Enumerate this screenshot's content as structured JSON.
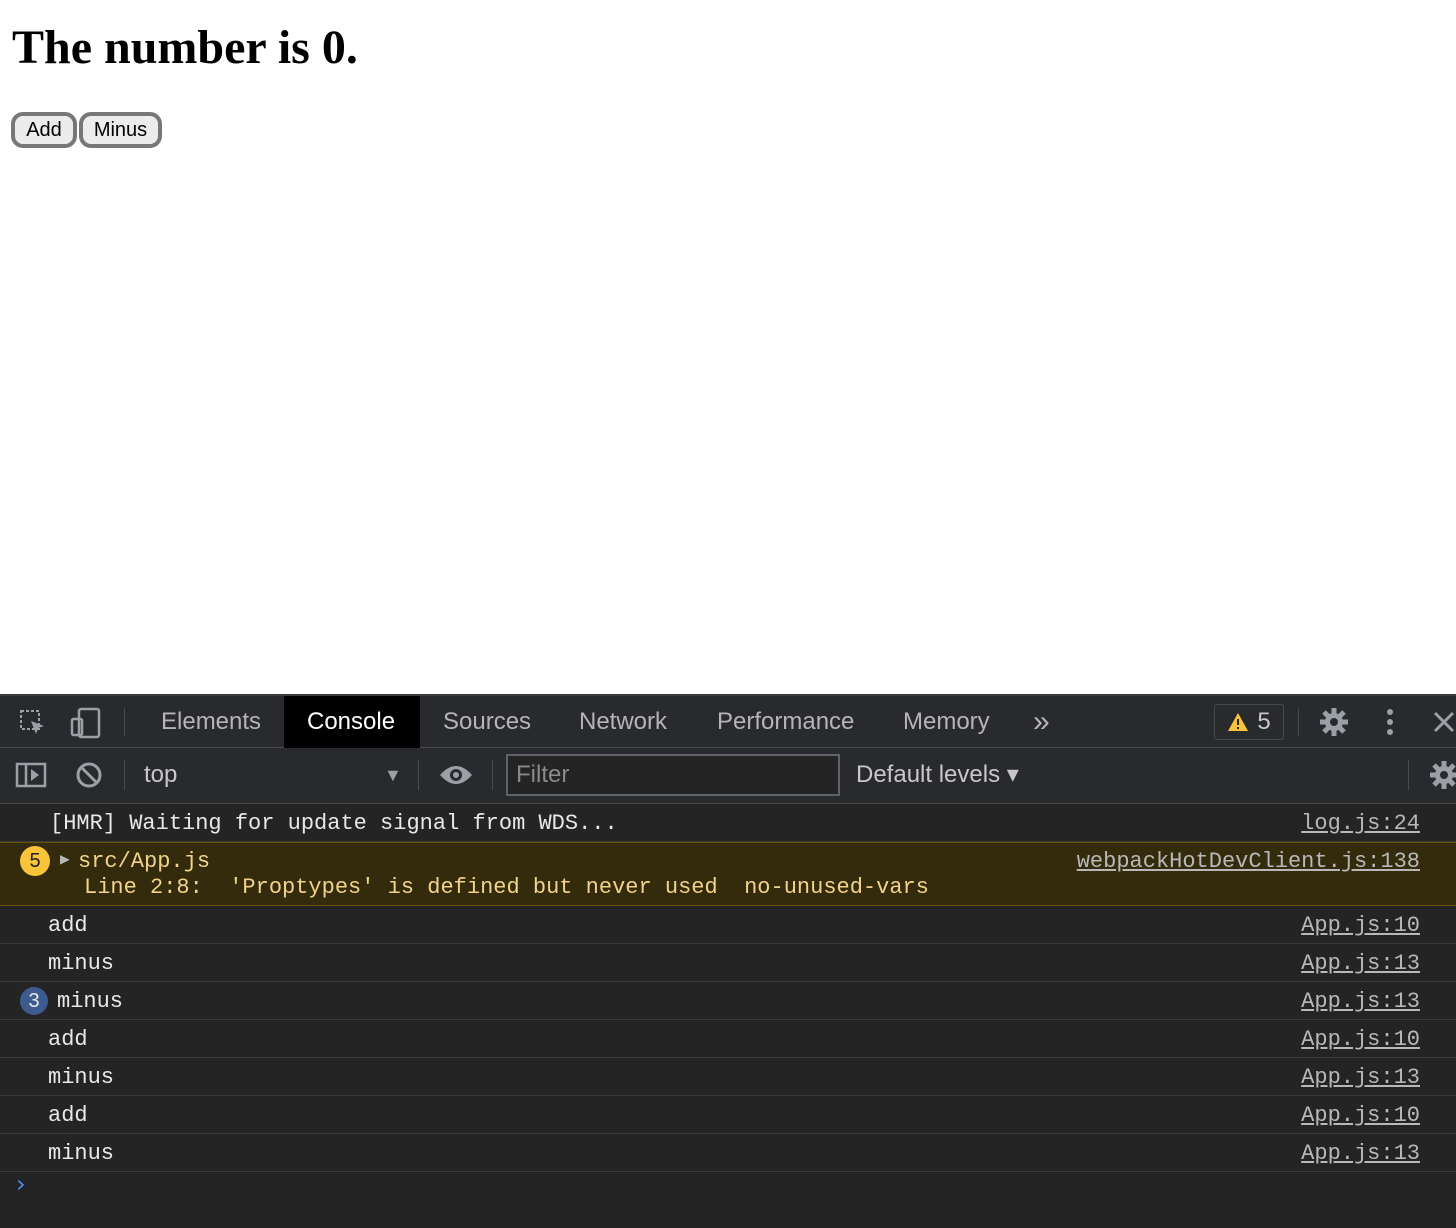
{
  "page": {
    "heading": "The number is 0.",
    "add_label": "Add",
    "minus_label": "Minus"
  },
  "devtools": {
    "tabs": [
      "Elements",
      "Console",
      "Sources",
      "Network",
      "Performance",
      "Memory"
    ],
    "active_tab": "Console",
    "more_tabs_glyph": "»",
    "warning_count": "5",
    "context": "top",
    "filter_placeholder": "Filter",
    "levels": "Default levels ▾",
    "console": [
      {
        "msg": "[HMR] Waiting for update signal from WDS...",
        "src": "log.js:24"
      },
      {
        "type": "warning",
        "count": "5",
        "msg": "src/App.js",
        "detail": "Line 2:8:  'Proptypes' is defined but never used  no-unused-vars",
        "src": "webpackHotDevClient.js:138"
      },
      {
        "msg": "add",
        "src": "App.js:10"
      },
      {
        "msg": "minus",
        "src": "App.js:13"
      },
      {
        "count": "3",
        "msg": "minus",
        "src": "App.js:13"
      },
      {
        "msg": "add",
        "src": "App.js:10"
      },
      {
        "msg": "minus",
        "src": "App.js:13"
      },
      {
        "msg": "add",
        "src": "App.js:10"
      },
      {
        "msg": "minus",
        "src": "App.js:13"
      }
    ],
    "prompt_glyph": "›"
  },
  "icons": [
    "inspect-element-icon",
    "device-toolbar-icon",
    "warning-icon",
    "settings-icon",
    "kebab-menu-icon",
    "close-icon",
    "sidebar-toggle-icon",
    "clear-console-icon",
    "eye-icon",
    "console-settings-icon"
  ],
  "colors": {
    "devtools_bg": "#242424",
    "toolbar_bg": "#292a2d",
    "warning_bg": "#332b0c",
    "warning_text": "#f2d38a",
    "prompt": "#4f8cf5"
  }
}
